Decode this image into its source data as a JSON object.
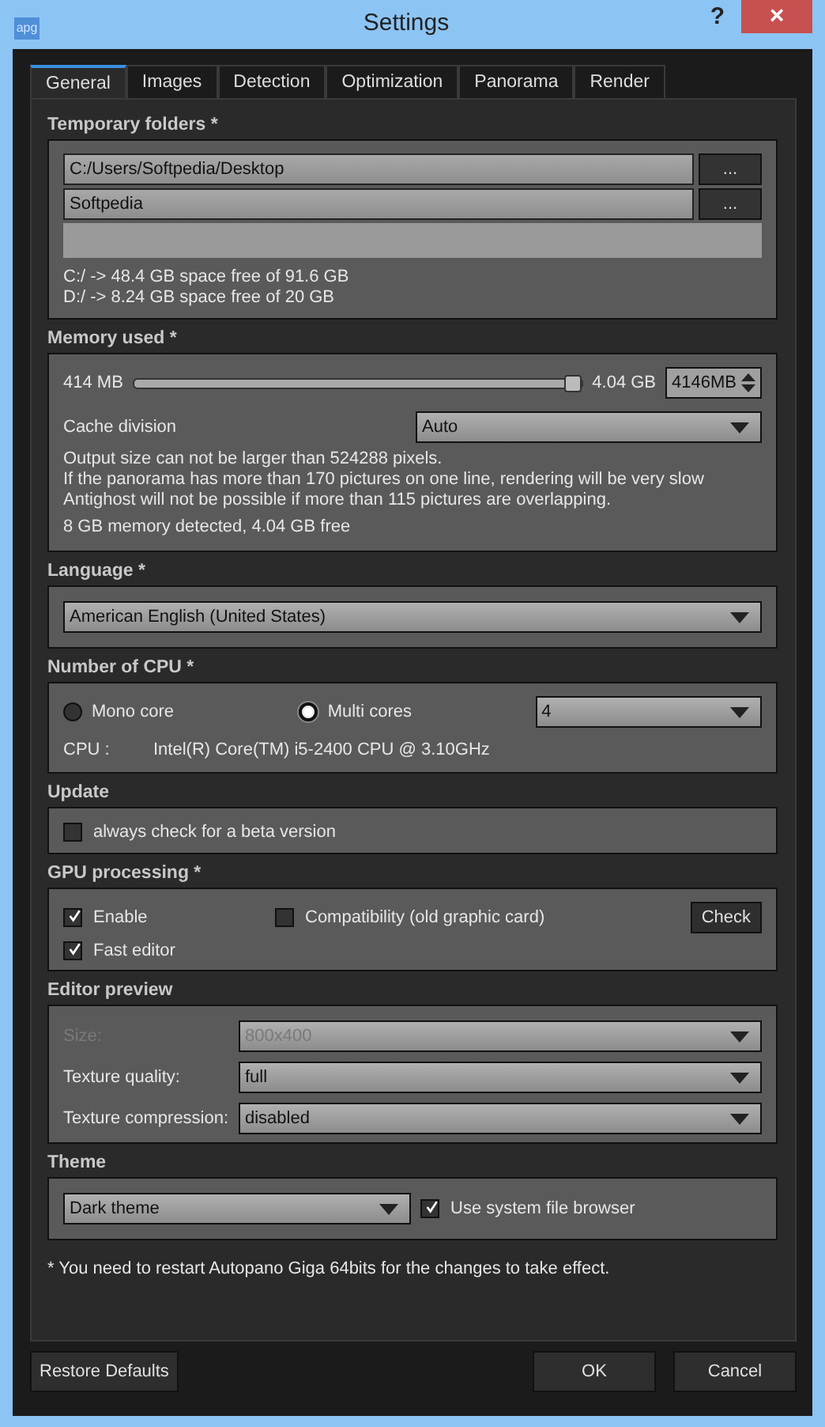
{
  "window": {
    "title": "Settings",
    "help": "?",
    "close": "×",
    "app_icon": "apg"
  },
  "tabs": [
    {
      "label": "General",
      "selected": true
    },
    {
      "label": "Images",
      "selected": false
    },
    {
      "label": "Detection",
      "selected": false
    },
    {
      "label": "Optimization",
      "selected": false
    },
    {
      "label": "Panorama",
      "selected": false
    },
    {
      "label": "Render",
      "selected": false
    }
  ],
  "temporary_folders": {
    "heading": "Temporary folders *",
    "folders": [
      {
        "path": "C:/Users/Softpedia/Desktop",
        "browse": "..."
      },
      {
        "path": "Softpedia",
        "browse": "..."
      }
    ],
    "space": [
      "C:/ -> 48.4 GB space free of 91.6 GB",
      "D:/ -> 8.24 GB space free of 20 GB"
    ]
  },
  "memory": {
    "heading": "Memory used *",
    "min": "414 MB",
    "max": "4.04 GB",
    "level": 0.98,
    "spin_value": "4146MB",
    "cache_label": "Cache division",
    "cache_value": "Auto",
    "notes": [
      "Output size can not be larger than 524288 pixels.",
      "If the panorama has more than 170 pictures on one line, rendering will be very slow",
      "Antighost will not be possible if more than 115 pictures are overlapping."
    ],
    "detected": "8 GB memory detected, 4.04 GB free"
  },
  "language": {
    "heading": "Language *",
    "value": "American English (United States)"
  },
  "cpu": {
    "heading": "Number of CPU *",
    "options": [
      {
        "label": "Mono core",
        "selected": false
      },
      {
        "label": "Multi cores",
        "selected": true
      }
    ],
    "cores": "4",
    "cpu_label": "CPU :",
    "cpu_name": "Intel(R) Core(TM) i5-2400 CPU @ 3.10GHz"
  },
  "update": {
    "heading": "Update",
    "beta": {
      "label": "always check for a beta version",
      "checked": false
    }
  },
  "gpu": {
    "heading": "GPU processing *",
    "enable": {
      "label": "Enable",
      "checked": true
    },
    "compatibility": {
      "label": "Compatibility (old graphic card)",
      "checked": false
    },
    "check_button": "Check",
    "fast_editor": {
      "label": "Fast editor",
      "checked": true
    }
  },
  "editor_preview": {
    "heading": "Editor preview",
    "rows": [
      {
        "label": "Size:",
        "value": "800x400",
        "disabled": true
      },
      {
        "label": "Texture quality:",
        "value": "full",
        "disabled": false
      },
      {
        "label": "Texture compression:",
        "value": "disabled",
        "disabled": false
      }
    ]
  },
  "theme": {
    "heading": "Theme",
    "value": "Dark theme",
    "system_browser": {
      "label": "Use system file browser",
      "checked": true
    }
  },
  "restart_note": "* You need to restart Autopano Giga 64bits for the changes to take effect.",
  "buttons": {
    "restore": "Restore Defaults",
    "ok": "OK",
    "cancel": "Cancel"
  }
}
